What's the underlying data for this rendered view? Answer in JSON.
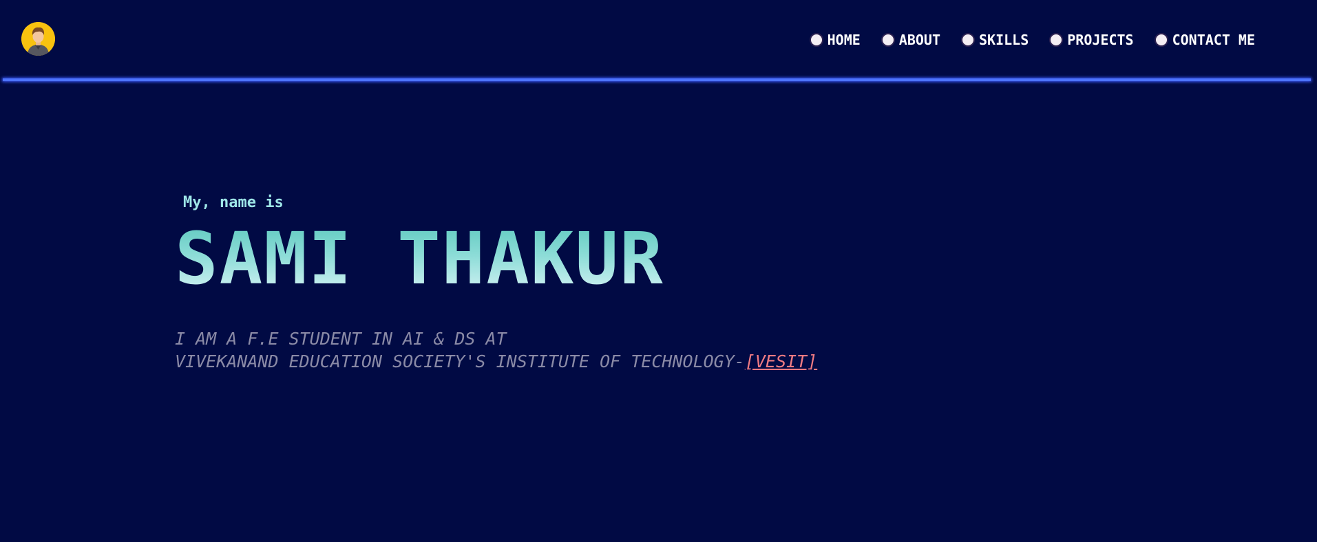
{
  "header": {
    "nav_items": [
      {
        "label": "HOME"
      },
      {
        "label": "ABOUT"
      },
      {
        "label": "SKILLS"
      },
      {
        "label": "PROJECTS"
      },
      {
        "label": "CONTACT ME"
      }
    ]
  },
  "hero": {
    "intro": "My, name is",
    "name": "SAMI THAKUR",
    "description_line1": "I AM A F.E STUDENT IN AI & DS AT",
    "description_line2": "VIVEKANAND EDUCATION SOCIETY'S INSTITUTE OF TECHNOLOGY-",
    "link_text": "[VESIT]"
  },
  "colors": {
    "background": "#010a44",
    "accent_line": "#4d74ff",
    "intro_text": "#9ee6e8",
    "link": "#ef7b82",
    "avatar_bg": "#f9c20f"
  }
}
